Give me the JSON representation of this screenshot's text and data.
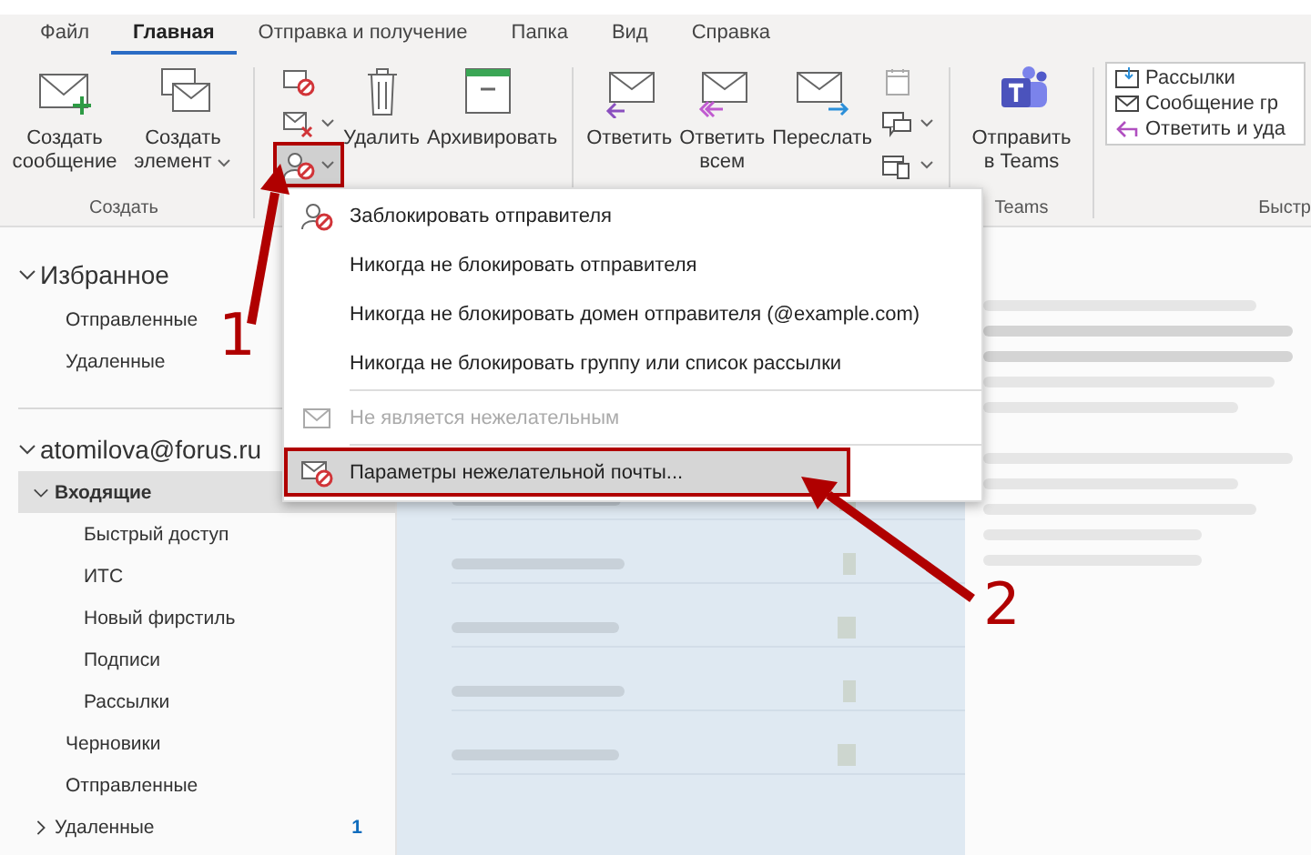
{
  "tabs": [
    {
      "label": "Файл",
      "selected": false
    },
    {
      "label": "Главная",
      "selected": true
    },
    {
      "label": "Отправка и получение",
      "selected": false
    },
    {
      "label": "Папка",
      "selected": false
    },
    {
      "label": "Вид",
      "selected": false
    },
    {
      "label": "Справка",
      "selected": false
    }
  ],
  "ribbon": {
    "create": {
      "label": "Создать",
      "new_message": "Создать сообщение",
      "new_item": "Создать элемент"
    },
    "delete": {
      "small_buttons": [
        {
          "kind": "ignore",
          "dropdown": false,
          "annotated": false
        },
        {
          "kind": "cleanup",
          "dropdown": true,
          "annotated": false
        },
        {
          "kind": "junk",
          "dropdown": true,
          "annotated": true
        }
      ],
      "delete": "Удалить",
      "archive": "Архивировать"
    },
    "respond": {
      "reply": "Ответить",
      "reply_all": "Ответить всем",
      "forward": "Переслать",
      "small_buttons": [
        {
          "kind": "meeting",
          "dropdown": false
        },
        {
          "kind": "chat",
          "dropdown": true
        },
        {
          "kind": "more",
          "dropdown": true
        }
      ]
    },
    "teams": {
      "button": "Отправить в Teams",
      "label": "Teams"
    },
    "quick_steps": {
      "items": [
        {
          "kind": "folder",
          "label": "Рассылки"
        },
        {
          "kind": "mail",
          "label": "Сообщение гр"
        },
        {
          "kind": "reply",
          "label": "Ответить и уда"
        }
      ],
      "label": "Быстр"
    }
  },
  "sidebar": {
    "favorites": {
      "label": "Избранное",
      "expanded": true,
      "items": [
        {
          "label": "Отправленные",
          "selected": false
        },
        {
          "label": "Удаленные",
          "selected": false
        }
      ]
    },
    "account": {
      "label": "atomilova@forus.ru",
      "expanded": true,
      "folders": [
        {
          "label": "Входящие",
          "selected": true,
          "expanded": true,
          "children": [
            {
              "label": "Быстрый доступ",
              "selected": false
            },
            {
              "label": "ИТС",
              "selected": false
            },
            {
              "label": "Новый фирстиль",
              "selected": false
            },
            {
              "label": "Подписи",
              "selected": false
            },
            {
              "label": "Рассылки",
              "selected": false
            }
          ]
        },
        {
          "label": "Черновики",
          "selected": false
        },
        {
          "label": "Отправленные",
          "selected": false
        },
        {
          "label": "Удаленные",
          "selected": false,
          "expanded": false,
          "count": "1"
        }
      ]
    }
  },
  "junk_menu": {
    "items": [
      {
        "kind": "block",
        "label": "Заблокировать отправителя",
        "disabled": false,
        "selected": false,
        "annotated": false
      },
      {
        "kind": "plain",
        "label": "Никогда не блокировать отправителя",
        "disabled": false,
        "selected": false,
        "annotated": false
      },
      {
        "kind": "plain",
        "label": "Никогда не блокировать домен отправителя (@example.com)",
        "disabled": false,
        "selected": false,
        "annotated": false
      },
      {
        "kind": "plain",
        "label": "Никогда не блокировать группу или список рассылки",
        "disabled": false,
        "selected": false,
        "annotated": false
      },
      {
        "kind": "not-junk",
        "label": "Не является нежелательным",
        "disabled": true,
        "selected": false,
        "annotated": false
      },
      {
        "kind": "options",
        "label": "Параметры нежелательной почты...",
        "disabled": false,
        "selected": true,
        "annotated": true
      }
    ]
  },
  "annotations": [
    {
      "label": "1"
    },
    {
      "label": "2"
    }
  ]
}
